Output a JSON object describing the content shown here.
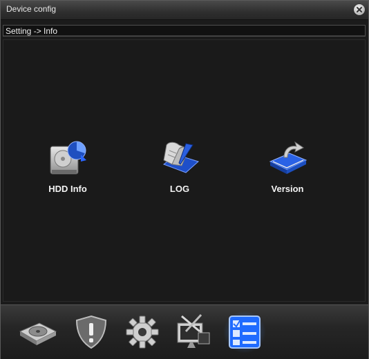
{
  "window": {
    "title": "Device config"
  },
  "breadcrumb": {
    "text": "Setting -> Info"
  },
  "items": [
    {
      "label": "HDD Info",
      "icon": "hdd-icon"
    },
    {
      "label": "LOG",
      "icon": "log-scroll-icon"
    },
    {
      "label": "Version",
      "icon": "version-book-icon"
    }
  ],
  "toolbar": [
    {
      "icon": "disk-icon"
    },
    {
      "icon": "shield-alert-icon"
    },
    {
      "icon": "gear-icon"
    },
    {
      "icon": "tools-monitor-icon"
    },
    {
      "icon": "checklist-icon",
      "active": true
    }
  ],
  "colors": {
    "active_glow": "#3f8cff",
    "background": "#1b1b1b",
    "text": "#f4f4f4"
  }
}
